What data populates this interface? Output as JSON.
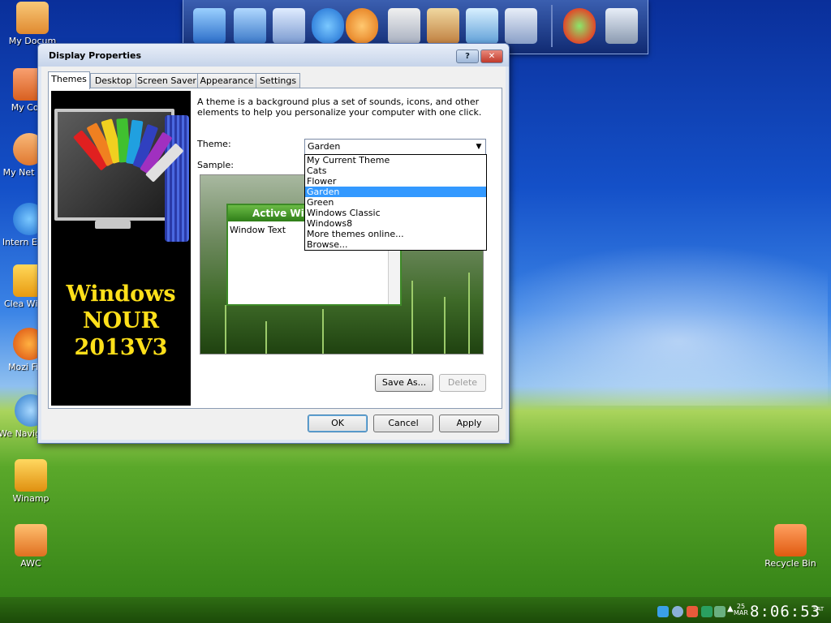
{
  "desktop": {
    "icons": [
      {
        "label": "My Docum",
        "color": "#f0a848"
      },
      {
        "label": "My Com",
        "color": "#f07a3a"
      },
      {
        "label": "My Net Plac",
        "color": "#f0a050"
      },
      {
        "label": "Intern Explo",
        "color": "#3a9af0"
      },
      {
        "label": "Clea Windo",
        "color": "#f5b820"
      },
      {
        "label": "Mozi Firef",
        "color": "#f08020"
      },
      {
        "label": "We Navigation",
        "color": "#5aa8e8"
      },
      {
        "label": "Winamp",
        "color": "#f5c030"
      },
      {
        "label": "AWC",
        "color": "#f0a040"
      },
      {
        "label": "Recycle Bin",
        "color": "#f07a20"
      }
    ]
  },
  "window": {
    "title": "Display Properties",
    "help_glyph": "?",
    "close_glyph": "✕",
    "tabs": [
      "Themes",
      "Desktop",
      "Screen Saver",
      "Appearance",
      "Settings"
    ],
    "active_tab": "Themes",
    "banner": {
      "line1": "Windows",
      "line2": "NOUR",
      "line3": "2013V3"
    },
    "description": "A theme is a background plus a set of sounds, icons, and other elements to help you personalize your computer with one click.",
    "theme_label": "Theme:",
    "sample_label": "Sample:",
    "theme_value": "Garden",
    "theme_options": [
      "My Current Theme",
      "Cats",
      "Flower",
      "Garden",
      "Green",
      "Windows Classic",
      "Windows8",
      "More themes online...",
      "Browse..."
    ],
    "selected_option": "Garden",
    "sample": {
      "title": "Active Win",
      "body": "Window Text"
    },
    "save_as_label": "Save As...",
    "delete_label": "Delete",
    "ok_label": "OK",
    "cancel_label": "Cancel",
    "apply_label": "Apply"
  },
  "tray": {
    "day_num": "25",
    "month": "MAR",
    "time": "8:06:53",
    "day_abbr": "SAT"
  },
  "colors": {
    "selection": "#3399ff",
    "banner_text": "#ffe01a",
    "sample_title_bar": "#2e7d18"
  }
}
